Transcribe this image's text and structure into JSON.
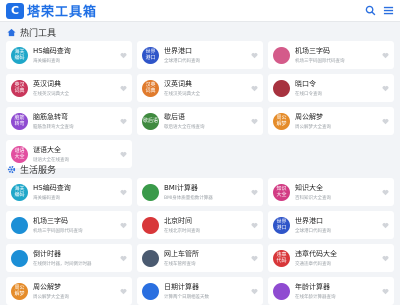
{
  "header": {
    "logo_mark": "C",
    "title": "塔荣工具箱"
  },
  "sections": [
    {
      "title": "热门工具",
      "cards": [
        {
          "title": "HS编码查询",
          "desc": "海关编码查询",
          "icon_text": "海关\n编码",
          "color": "#1fa7c9"
        },
        {
          "title": "世界港口",
          "desc": "全球港口代码查询",
          "icon_text": "世界\n港口",
          "color": "#2f55c9"
        },
        {
          "title": "机场三字码",
          "desc": "机场三字码国际代码查询",
          "icon_text": "",
          "color": "#d45b8a"
        },
        {
          "title": "英汉词典",
          "desc": "在线英汉词典大全",
          "icon_text": "英汉\n词典",
          "color": "#c9365b"
        },
        {
          "title": "汉英词典",
          "desc": "在线汉英词典大全",
          "icon_text": "汉英\n词典",
          "color": "#e07b2d"
        },
        {
          "title": "晓口令",
          "desc": "在线口令查询",
          "icon_text": "",
          "color": "#a7323f"
        },
        {
          "title": "脑筋急转弯",
          "desc": "脑筋急转弯大全查询",
          "icon_text": "脑筋\n转弯",
          "color": "#8f4bd1"
        },
        {
          "title": "歇后语",
          "desc": "歇后语大全在线查询",
          "icon_text": "歇后语",
          "color": "#3f8a3f"
        },
        {
          "title": "周公解梦",
          "desc": "周公解梦大全查询",
          "icon_text": "周公\n解梦",
          "color": "#e58c2a"
        },
        {
          "title": "谜语大全",
          "desc": "谜语大全在线查询",
          "icon_text": "谜语\n大全",
          "color": "#e24fa0"
        }
      ]
    },
    {
      "title": "生活服务",
      "cards": [
        {
          "title": "HS编码查询",
          "desc": "海关编码查询",
          "icon_text": "海关\n编码",
          "color": "#1fa7c9"
        },
        {
          "title": "BMI计算器",
          "desc": "BMI身体质量指数计算器",
          "icon_text": "",
          "color": "#3a9a4a"
        },
        {
          "title": "知识大全",
          "desc": "百科知识大全查询",
          "icon_text": "知识\n大全",
          "color": "#d23c84"
        },
        {
          "title": "机场三字码",
          "desc": "机场三字码国际代码查询",
          "icon_text": "",
          "color": "#1c8fd6"
        },
        {
          "title": "北京时间",
          "desc": "在线北京时间查询",
          "icon_text": "",
          "color": "#d8373a"
        },
        {
          "title": "世界港口",
          "desc": "全球港口代码查询",
          "icon_text": "世界\n港口",
          "color": "#2f55c9"
        },
        {
          "title": "倒计时器",
          "desc": "在线倒计时器，时间倒计时器",
          "icon_text": "",
          "color": "#1c8fd6"
        },
        {
          "title": "网上车管所",
          "desc": "在线车管所查询",
          "icon_text": "",
          "color": "#4a5a70"
        },
        {
          "title": "违章代码大全",
          "desc": "交通违章代码查询",
          "icon_text": "违章\n代码",
          "color": "#d8373a"
        },
        {
          "title": "周公解梦",
          "desc": "周公解梦大全查询",
          "icon_text": "周公\n解梦",
          "color": "#e58c2a"
        },
        {
          "title": "日期计算器",
          "desc": "计算两个日期相差天数",
          "icon_text": "",
          "color": "#2a6fe0"
        },
        {
          "title": "年龄计算器",
          "desc": "在线年龄计算器查询",
          "icon_text": "",
          "color": "#8f4bd1"
        }
      ]
    }
  ]
}
